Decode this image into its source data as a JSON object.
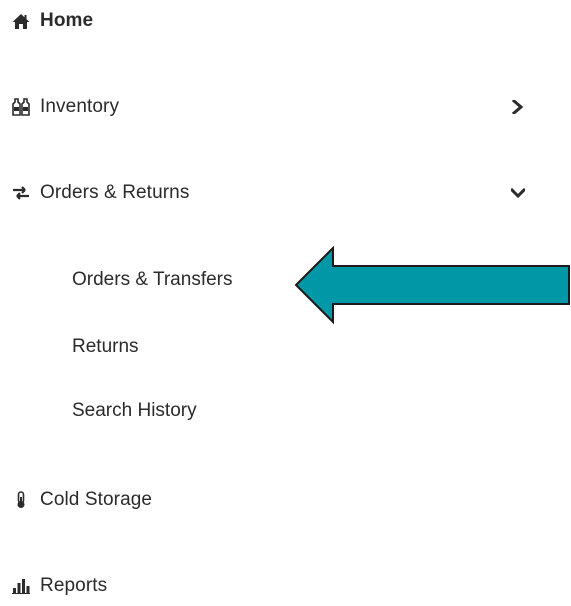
{
  "sidebar": {
    "items": [
      {
        "label": "Home",
        "icon": "home-icon"
      },
      {
        "label": "Inventory",
        "icon": "bottles-icon",
        "expander": "chevron-right-icon"
      },
      {
        "label": "Orders & Returns",
        "icon": "exchange-icon",
        "expander": "chevron-down-icon"
      },
      {
        "label": "Cold Storage",
        "icon": "thermometer-icon"
      },
      {
        "label": "Reports",
        "icon": "bar-chart-icon"
      }
    ],
    "orders_submenu": [
      {
        "label": "Orders & Transfers"
      },
      {
        "label": "Returns"
      },
      {
        "label": "Search History"
      }
    ]
  },
  "annotation": {
    "arrow_color": "#0097a7",
    "arrow_outline": "#1a1a1a"
  }
}
